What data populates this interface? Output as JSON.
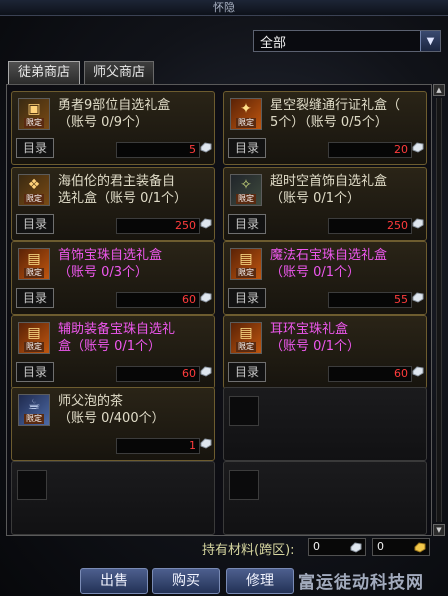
{
  "window": {
    "title": "怀隐"
  },
  "filter": {
    "selected": "全部"
  },
  "tabs": [
    {
      "label": "徒弟商店",
      "active": true
    },
    {
      "label": "师父商店",
      "active": false
    }
  ],
  "items": [
    {
      "name": "勇者9部位自选礼盒\n（账号 0/9个）",
      "price": "5",
      "dir": "目录",
      "color": "#e0dcc8",
      "icon": "gift-box-icon",
      "limit": "限定"
    },
    {
      "name": "星空裂缝通行证礼盒（\n5个）（账号 0/5个）",
      "price": "20",
      "dir": "目录",
      "color": "#e0dcc8",
      "icon": "pass-ticket-icon",
      "limit": "限定"
    },
    {
      "name": "海伯伦的君主装备自\n选礼盒（账号 0/1个）",
      "price": "250",
      "dir": "目录",
      "color": "#e0dcc8",
      "icon": "gift-box-icon",
      "limit": "限定"
    },
    {
      "name": "超时空首饰自选礼盒\n（账号 0/1个）",
      "price": "250",
      "dir": "目录",
      "color": "#e0dcc8",
      "icon": "gift-box-icon",
      "limit": "限定"
    },
    {
      "name": "首饰宝珠自选礼盒\n（账号 0/3个）",
      "price": "60",
      "dir": "目录",
      "color": "#ef58ef",
      "icon": "treasure-chest-icon",
      "limit": "限定"
    },
    {
      "name": "魔法石宝珠自选礼盒\n（账号 0/1个）",
      "price": "55",
      "dir": "目录",
      "color": "#ef58ef",
      "icon": "treasure-chest-icon",
      "limit": "限定"
    },
    {
      "name": "辅助装备宝珠自选礼\n盒（账号 0/1个）",
      "price": "60",
      "dir": "目录",
      "color": "#ef58ef",
      "icon": "treasure-chest-icon",
      "limit": "限定"
    },
    {
      "name": "耳环宝珠礼盒\n（账号 0/1个）",
      "price": "60",
      "dir": "目录",
      "color": "#ef58ef",
      "icon": "treasure-chest-icon",
      "limit": "限定"
    },
    {
      "name": "师父泡的茶\n（账号 0/400个）",
      "price": "1",
      "dir": "目录",
      "color": "#e0dcc8",
      "icon": "tea-icon",
      "limit": "限定"
    }
  ],
  "materials": {
    "label": "持有材料(跨区):",
    "value1": "0",
    "value2": "0"
  },
  "buttons": {
    "sell": "出售",
    "buy": "购买",
    "repair": "修理"
  },
  "watermark": "富运徒动科技网",
  "colors": {
    "accent_blue": "#233256",
    "price_red": "#ff3c3c",
    "pink_name": "#ef58ef",
    "gold_border": "#6d5c2f"
  }
}
